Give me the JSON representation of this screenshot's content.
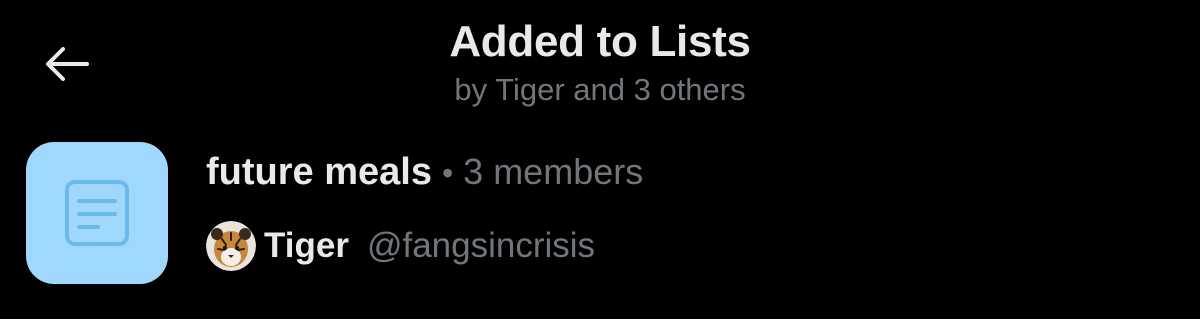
{
  "header": {
    "title": "Added to Lists",
    "subtitle": "by Tiger and 3 others"
  },
  "icons": {
    "back": "arrow-left-icon",
    "list": "list-document-icon"
  },
  "lists": [
    {
      "name": "future meals",
      "separator": "•",
      "members": "3 members",
      "owner_name": "Tiger",
      "owner_handle": "@fangsincrisis"
    }
  ],
  "colors": {
    "background": "#000000",
    "primary_text": "#e7e9ea",
    "secondary_text": "#71767b",
    "list_avatar_bg": "#9fd8fc",
    "list_icon": "#6cb9ec"
  }
}
